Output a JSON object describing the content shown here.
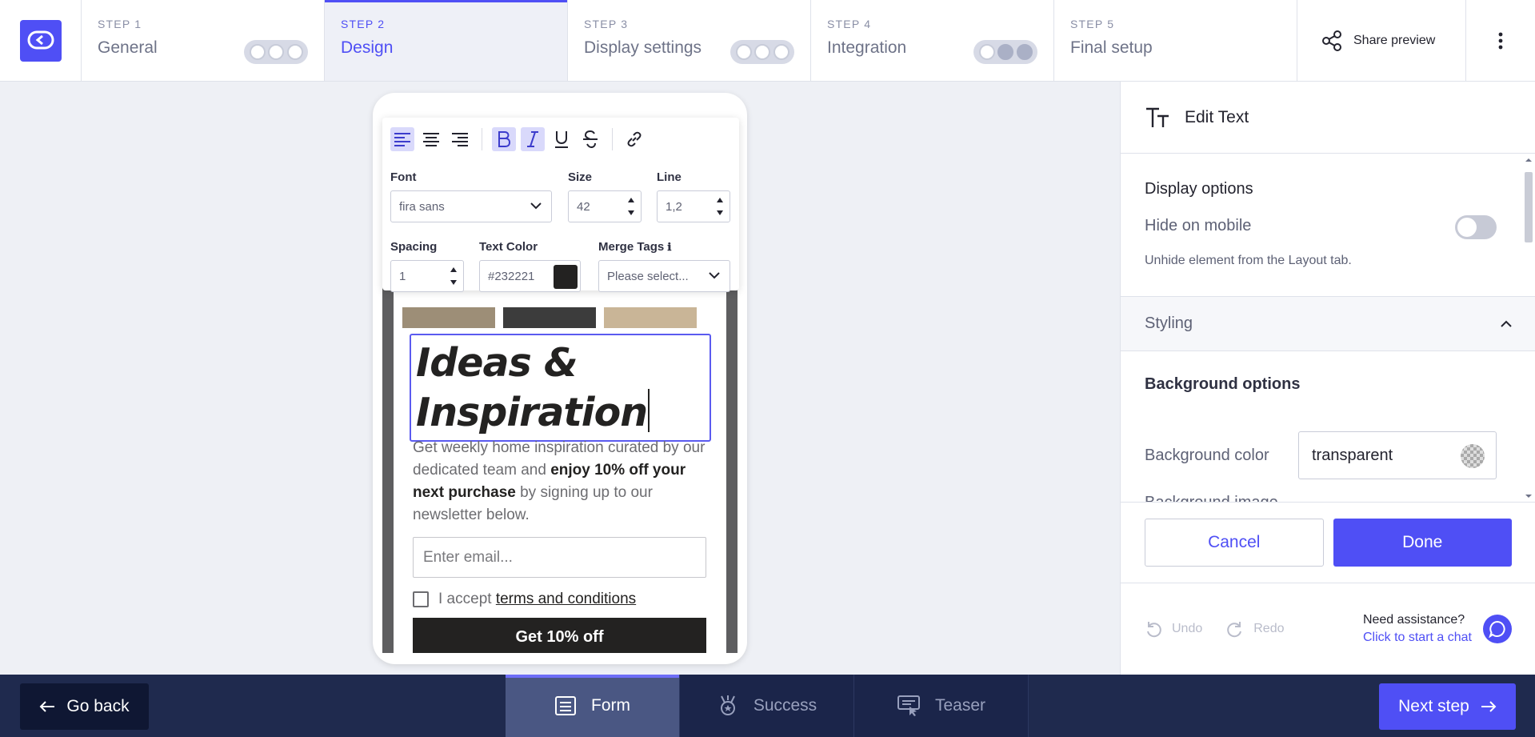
{
  "steps": [
    {
      "num": "STEP 1",
      "title": "General",
      "dots": [
        false,
        false,
        false
      ]
    },
    {
      "num": "STEP 2",
      "title": "Design",
      "active": true
    },
    {
      "num": "STEP 3",
      "title": "Display settings",
      "dots": [
        false,
        false,
        false
      ]
    },
    {
      "num": "STEP 4",
      "title": "Integration",
      "dots": [
        false,
        true,
        true
      ]
    },
    {
      "num": "STEP 5",
      "title": "Final setup"
    }
  ],
  "header": {
    "share_label": "Share preview",
    "more_icon": "more-vertical-icon",
    "logo_icon": "chat-bubble-logo"
  },
  "toolbar": {
    "font_label": "Font",
    "font_value": "fira sans",
    "size_label": "Size",
    "size_value": "42",
    "line_label": "Line",
    "line_value": "1,2",
    "spacing_label": "Spacing",
    "spacing_value": "1",
    "color_label": "Text Color",
    "color_value": "#232221",
    "merge_label": "Merge Tags",
    "merge_info": "ℹ",
    "merge_placeholder": "Please select..."
  },
  "form": {
    "headline_line1": "Ideas &",
    "headline_line2": "Inspiration",
    "body_pre": "Get weekly home inspiration curated by our dedicated team and ",
    "body_bold1": "enjoy 10% off your next purchase",
    "body_post": " by signing up to our newsletter below.",
    "email_placeholder": "Enter email...",
    "terms_pre": "I accept ",
    "terms_link": "terms and conditions",
    "cta_label": "Get 10% off"
  },
  "panel": {
    "title": "Edit Text",
    "display_title": "Display options",
    "hide_mobile_label": "Hide on mobile",
    "hide_mobile_on": false,
    "hint": "Unhide element from the Layout tab.",
    "styling_label": "Styling",
    "bg_title": "Background options",
    "bg_color_label": "Background color",
    "bg_color_value": "transparent",
    "bg_image_label": "Background image",
    "cancel_label": "Cancel",
    "done_label": "Done",
    "undo_label": "Undo",
    "redo_label": "Redo",
    "assist_title": "Need assistance?",
    "assist_link": "Click to start a chat"
  },
  "bottom": {
    "goback_label": "Go back",
    "tabs": [
      {
        "label": "Form",
        "active": true,
        "icon": "form-icon"
      },
      {
        "label": "Success",
        "icon": "trophy-icon"
      },
      {
        "label": "Teaser",
        "icon": "teaser-icon"
      }
    ],
    "next_label": "Next step"
  },
  "colors": {
    "accent": "#4f4ff5",
    "bottom_bar": "#1f2a4e",
    "text_color": "#232221"
  }
}
